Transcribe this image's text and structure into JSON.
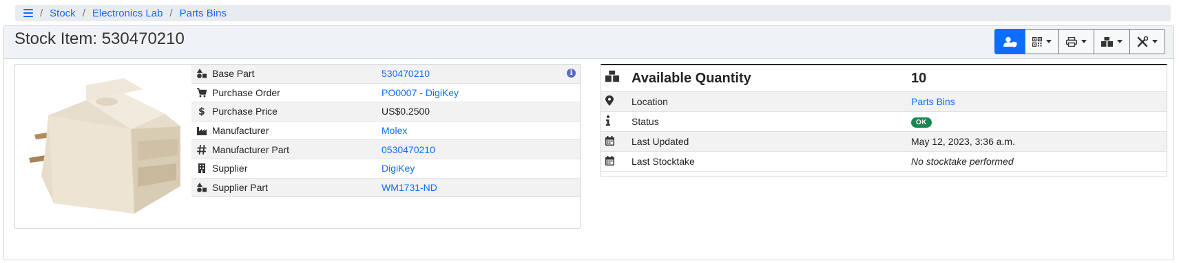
{
  "breadcrumb": {
    "items": [
      {
        "label": "Stock"
      },
      {
        "label": "Electronics Lab"
      },
      {
        "label": "Parts Bins"
      }
    ],
    "separator": "/"
  },
  "header": {
    "title": "Stock Item: 530470210",
    "toolbar_icons": [
      "user-shield-icon",
      "qr-code-icon",
      "print-icon",
      "boxes-icon",
      "tools-icon"
    ]
  },
  "details": [
    {
      "icon": "shapes-icon",
      "label": "Base Part",
      "value": "530470210",
      "link": true
    },
    {
      "icon": "cart-icon",
      "label": "Purchase Order",
      "value": "PO0007 - DigiKey",
      "link": true
    },
    {
      "icon": "dollar-icon",
      "label": "Purchase Price",
      "value": "US$0.2500",
      "link": false
    },
    {
      "icon": "industry-icon",
      "label": "Manufacturer",
      "value": "Molex",
      "link": true
    },
    {
      "icon": "hashtag-icon",
      "label": "Manufacturer Part",
      "value": "0530470210",
      "link": true
    },
    {
      "icon": "building-icon",
      "label": "Supplier",
      "value": "DigiKey",
      "link": true
    },
    {
      "icon": "shapes-icon",
      "label": "Supplier Part",
      "value": "WM1731-ND",
      "link": true
    }
  ],
  "info_badge": "i",
  "stock": {
    "quantity_label": "Available Quantity",
    "quantity_value": "10",
    "rows": [
      {
        "icon": "location-icon",
        "label": "Location",
        "value": "Parts Bins",
        "type": "link"
      },
      {
        "icon": "info-icon",
        "label": "Status",
        "value": "OK",
        "type": "badge"
      },
      {
        "icon": "calendar-icon",
        "label": "Last Updated",
        "value": "May 12, 2023, 3:36 a.m.",
        "type": "text"
      },
      {
        "icon": "calendar-icon",
        "label": "Last Stocktake",
        "value": "No stocktake performed",
        "type": "italic"
      }
    ]
  },
  "colors": {
    "link": "#0d6efd",
    "primary_button": "#0d6efd",
    "ok_badge": "#198754",
    "info_badge": "#5c6bc0"
  }
}
